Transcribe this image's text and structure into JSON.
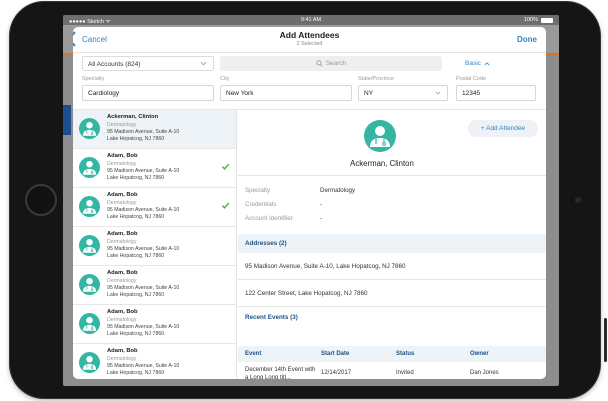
{
  "statusbar": {
    "carrier": "●●●●● Sketch ᯤ",
    "time": "9:41 AM",
    "battery": "100%"
  },
  "nav": {
    "cancel": "Cancel",
    "title": "Add Attendees",
    "subtitle": "2 Selected",
    "done": "Done"
  },
  "toolbar": {
    "accounts": "All Accounts (824)",
    "search_placeholder": "Search",
    "mode": "Basic"
  },
  "filters": {
    "specialty": {
      "label": "Specialty",
      "value": "Cardiology"
    },
    "city": {
      "label": "City",
      "value": "New York"
    },
    "state": {
      "label": "State/Province",
      "value": "NY"
    },
    "postal": {
      "label": "Postal Code",
      "value": "12345"
    }
  },
  "list": [
    {
      "name": "Ackerman, Clinton",
      "specialty": "Dermatology",
      "address1": "95 Madison Avenue, Suite A-10",
      "address2": "Lake Hopatcog, NJ 7860",
      "checked": false,
      "selected": true
    },
    {
      "name": "Adam, Bob",
      "specialty": "Dermatology",
      "address1": "95 Madison Avenue, Suite A-10",
      "address2": "Lake Hopatcog, NJ 7860",
      "checked": true,
      "selected": false
    },
    {
      "name": "Adam, Bob",
      "specialty": "Dermatology",
      "address1": "95 Madison Avenue, Suite A-10",
      "address2": "Lake Hopatcog, NJ 7860",
      "checked": true,
      "selected": false
    },
    {
      "name": "Adam, Bob",
      "specialty": "Dermatology",
      "address1": "95 Madison Avenue, Suite A-10",
      "address2": "Lake Hopatcog, NJ 7860",
      "checked": false,
      "selected": false
    },
    {
      "name": "Adam, Bob",
      "specialty": "Dermatology",
      "address1": "95 Madison Avenue, Suite A-10",
      "address2": "Lake Hopatcog, NJ 7860",
      "checked": false,
      "selected": false
    },
    {
      "name": "Adam, Bob",
      "specialty": "Dermatology",
      "address1": "95 Madison Avenue, Suite A-10",
      "address2": "Lake Hopatcog, NJ 7860",
      "checked": false,
      "selected": false
    },
    {
      "name": "Adam, Bob",
      "specialty": "Dermatology",
      "address1": "95 Madison Avenue, Suite A-10",
      "address2": "Lake Hopatcog, NJ 7860",
      "checked": false,
      "selected": false
    }
  ],
  "detail": {
    "add_button": "+ Add Attendee",
    "name": "Ackerman, Clinton",
    "fields": [
      {
        "label": "Specialty",
        "value": "Dermatology"
      },
      {
        "label": "Credentials",
        "value": "-"
      },
      {
        "label": "Account Identifier",
        "value": "-"
      }
    ],
    "addresses_header": "Addresses (2)",
    "addresses": [
      "95 Madison Avenue, Suite A-10, Lake Hopatcog, NJ 7860",
      "122 Center Street, Lake Hopatcog, NJ 7860"
    ],
    "events_header": "Recent Events (3)",
    "events_columns": [
      "Event",
      "Start Date",
      "Status",
      "Owner"
    ],
    "events": [
      {
        "event": "December 14th Event with a Long Long titl...",
        "start": "12/14/2017",
        "status": "Invited",
        "owner": "Dan Jones"
      }
    ]
  },
  "colors": {
    "accent": "#2f86c6",
    "avatar": "#33b6a4",
    "section_bg": "#eef3f8",
    "check": "#4caf50"
  }
}
